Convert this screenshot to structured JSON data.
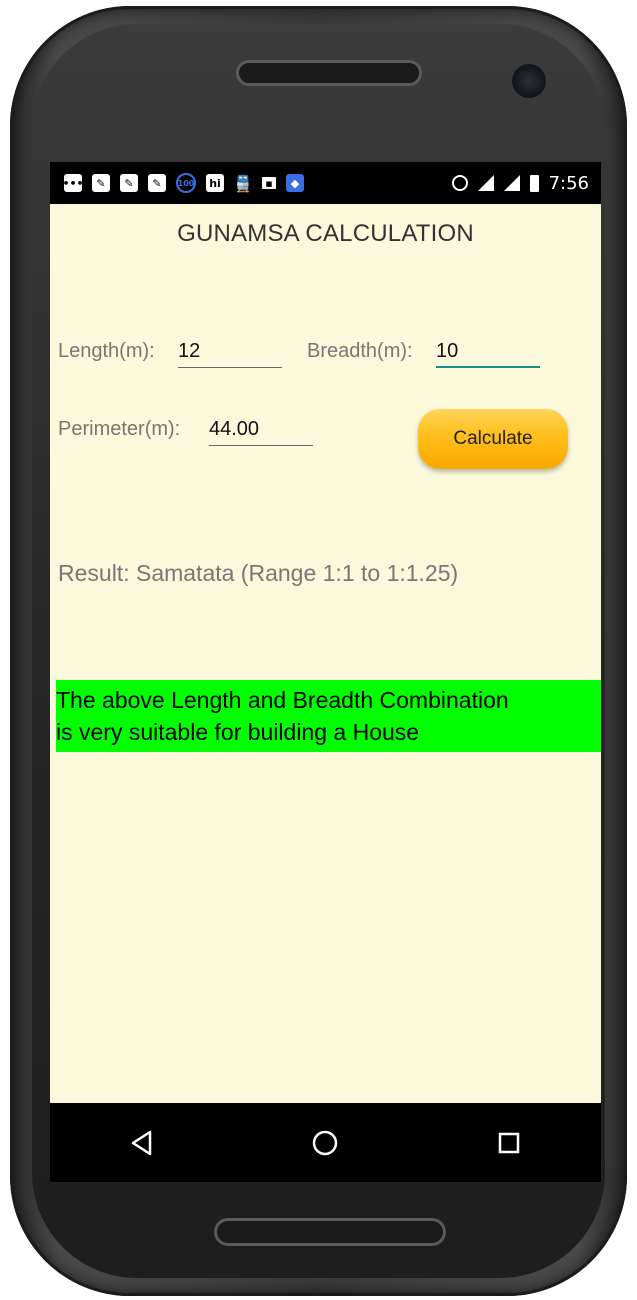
{
  "status_bar": {
    "time": "7:56",
    "notification_icons": [
      "chat-icon",
      "app-icon",
      "app-icon",
      "app-icon",
      "speedometer-icon",
      "hi-icon",
      "train-icon",
      "image-icon",
      "map-icon"
    ],
    "system_icons": [
      "alarm-icon",
      "signal-icon",
      "signal-icon",
      "battery-icon"
    ],
    "badge_text": "100",
    "hi_text": "hi"
  },
  "app": {
    "title": "GUNAMSA CALCULATION",
    "length_label": "Length(m):",
    "length_value": "12",
    "breadth_label": "Breadth(m):",
    "breadth_value": "10",
    "perimeter_label": "Perimeter(m):",
    "perimeter_value": "44.00",
    "calculate_label": "Calculate",
    "result_text": "Result: Samatata (Range 1:1 to 1:1.25)",
    "suitability_line1": "The above Length and Breadth Combination",
    "suitability_line2": "is very suitable for building a House"
  },
  "navbar": {
    "buttons": [
      "back-icon",
      "home-icon",
      "recents-icon"
    ]
  },
  "colors": {
    "screen_bg": "#fbf8dc",
    "highlight": "#00ff00",
    "button": "#ffbe1a",
    "focus_underline": "#1a8f85"
  }
}
